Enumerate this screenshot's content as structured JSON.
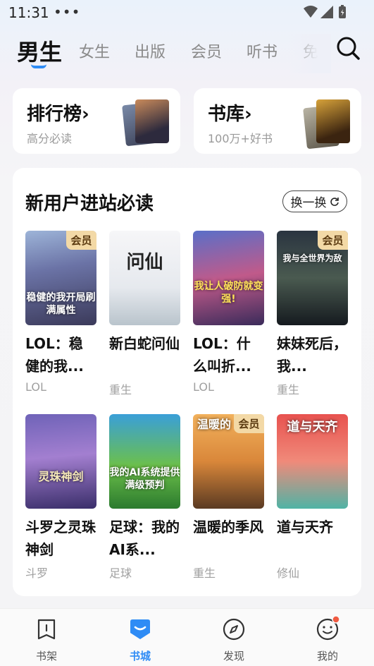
{
  "status_bar": {
    "time": "11:31",
    "dots": "•••"
  },
  "top_tabs": [
    {
      "label": "男生",
      "active": true
    },
    {
      "label": "女生"
    },
    {
      "label": "出版"
    },
    {
      "label": "会员"
    },
    {
      "label": "听书"
    },
    {
      "label": "免"
    }
  ],
  "quick_entries": [
    {
      "title": "排行榜›",
      "subtitle": "高分必读"
    },
    {
      "title": "书库›",
      "subtitle": "100万+好书"
    }
  ],
  "section": {
    "title": "新用户进站必读",
    "refresh_label": "换一换",
    "books": [
      {
        "title": "LOL：稳健的我...",
        "tag": "LOL",
        "badge": "会员",
        "cover_text": "稳健的我开局刷满属性"
      },
      {
        "title": "新白蛇问仙",
        "tag": "重生",
        "badge": "",
        "cover_text": "问仙"
      },
      {
        "title": "LOL：什么叫折...",
        "tag": "LOL",
        "badge": "",
        "cover_text": "我让人破防就变强!"
      },
      {
        "title": "妹妹死后，我...",
        "tag": "重生",
        "badge": "会员",
        "cover_text": "我与全世界为敌"
      },
      {
        "title": "斗罗之灵珠神剑",
        "tag": "斗罗",
        "badge": "",
        "cover_text": "灵珠神剑"
      },
      {
        "title": "足球：我的AI系...",
        "tag": "足球",
        "badge": "",
        "cover_text": "我的AI系统提供满级预判"
      },
      {
        "title": "温暖的季风",
        "tag": "重生",
        "badge": "会员",
        "cover_text": "温暖的"
      },
      {
        "title": "道与天齐",
        "tag": "修仙",
        "badge": "",
        "cover_text": "道与天齐"
      }
    ]
  },
  "bottom_nav": [
    {
      "label": "书架",
      "icon": "bookshelf-icon"
    },
    {
      "label": "书城",
      "icon": "bookstore-icon",
      "active": true
    },
    {
      "label": "发现",
      "icon": "compass-icon"
    },
    {
      "label": "我的",
      "icon": "profile-icon"
    }
  ],
  "colors": {
    "accent": "#2f8cf5",
    "badge_bg": "#f3d9a6",
    "notification_dot": "#f05b42"
  }
}
